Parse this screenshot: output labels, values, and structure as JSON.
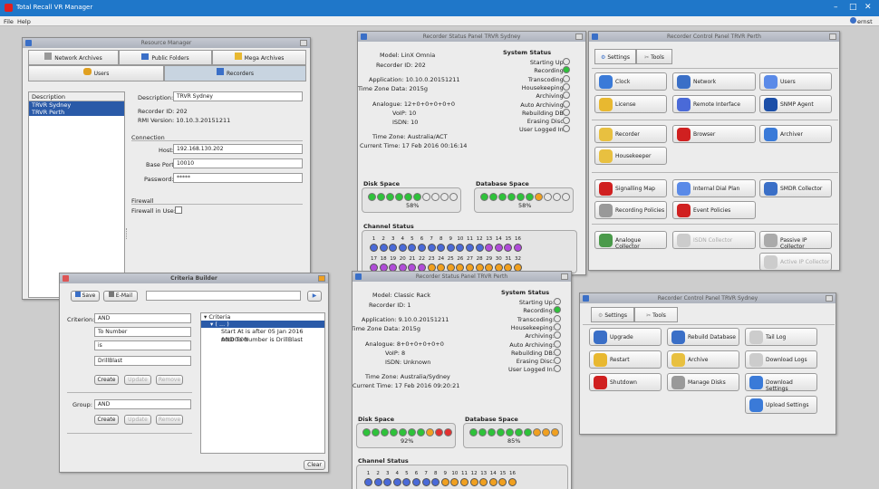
{
  "app": {
    "title": "Total Recall VR Manager",
    "menu": [
      "File",
      "Help"
    ],
    "user": "ernst"
  },
  "resmgr": {
    "title": "Resource Manager",
    "tabs": [
      "Network Archives",
      "Public Folders",
      "Mega Archives",
      "Users",
      "Recorders"
    ],
    "list_header": "Description",
    "list": [
      "TRVR Sydney",
      "TRVR Perth"
    ],
    "description_label": "Description:",
    "description": "TRVR Sydney",
    "recorder_id": "Recorder ID: 202",
    "rmi_version": "RMI Version: 10.10.3.20151211",
    "connection": "Connection",
    "host_label": "Host:",
    "host": "192.168.130.202",
    "port_label": "Base Port:",
    "port": "10010",
    "password_label": "Password:",
    "password": "*****",
    "firewall": "Firewall",
    "firewall_in_use": "Firewall in Use:"
  },
  "criteria": {
    "title": "Criteria Builder",
    "save": "Save",
    "email": "E-Mail",
    "go": "▶",
    "criterion_label": "Criterion:",
    "criterion": "AND",
    "field2": "To Number",
    "op": "is",
    "value": "DrillBlast",
    "create": "Create",
    "update": "Update",
    "remove": "Remove",
    "group_label": "Group:",
    "group": "AND",
    "clear": "Clear",
    "tree": [
      "Criteria",
      "( ... )",
      "Start At is after 05 Jan 2016 00:00:00",
      "AND To Number is DrillBlast"
    ]
  },
  "sydney": {
    "title": "Recorder Status Panel TRVR Sydney",
    "model": "Model: LinX Omnia",
    "rid": "Recorder ID: 202",
    "app": "Application: 10.10.0.20151211",
    "tzdata": "Time Zone Data: 2015g",
    "analogue": "Analogue: 12+0+0+0+0+0",
    "voip": "VoIP: 10",
    "isdn": "ISDN: 10",
    "tz": "Time Zone: Australia/ACT",
    "time": "Current Time: 17 Feb 2016 00:16:14",
    "disk_label": "Disk Space",
    "disk_pct": "58%",
    "db_label": "Database Space",
    "db_pct": "58%",
    "channel_label": "Channel Status"
  },
  "perth": {
    "title": "Recorder Status Panel TRVR Perth",
    "model": "Model: Classic Rack",
    "rid": "Recorder ID: 1",
    "app": "Application: 9.10.0.20151211",
    "tzdata": "Time Zone Data: 2015g",
    "analogue": "Analogue: 8+0+0+0+0+0",
    "voip": "VoIP: 8",
    "isdn": "ISDN: Unknown",
    "tz": "Time Zone: Australia/Sydney",
    "time": "Current Time: 17 Feb 2016 09:20:21",
    "disk_label": "Disk Space",
    "disk_pct": "92%",
    "db_label": "Database Space",
    "db_pct": "85%",
    "channel_label": "Channel Status"
  },
  "status_items": {
    "heading": "System Status",
    "items": [
      "Starting Up:",
      "Recording:",
      "Transcoding:",
      "Housekeeping:",
      "Archiving:",
      "Auto Archiving:",
      "Rebuilding DB:",
      "Erasing Disc:",
      "User Logged In:"
    ]
  },
  "cp_perth": {
    "title": "Recorder Control Panel TRVR Perth",
    "tab_settings": "Settings",
    "tab_tools": "Tools",
    "buttons": [
      "Clock",
      "Network",
      "Users",
      "License",
      "Remote Interface",
      "SNMP Agent",
      "Recorder",
      "Browser",
      "Archiver",
      "Housekeeper",
      "Signalling Map",
      "Internal Dial Plan",
      "SMDR Collector",
      "Recording Policies",
      "Event Policies",
      "Analogue Collector",
      "ISDN Collector",
      "Passive IP Collector",
      "Active IP Collector"
    ]
  },
  "cp_sydney": {
    "title": "Recorder Control Panel TRVR Sydney",
    "tab_settings": "Settings",
    "tab_tools": "Tools",
    "buttons": [
      "Upgrade",
      "Rebuild Database",
      "Tail Log",
      "Restart",
      "Archive",
      "Download Logs",
      "Shutdown",
      "Manage Disks",
      "Download Settings",
      "Upload Settings"
    ]
  },
  "colors": {
    "accent": "#1f77c9",
    "green": "#2ec23a",
    "orange": "#f0a020",
    "red": "#e23030",
    "blue": "#4060d0",
    "purple": "#b04cd8"
  }
}
